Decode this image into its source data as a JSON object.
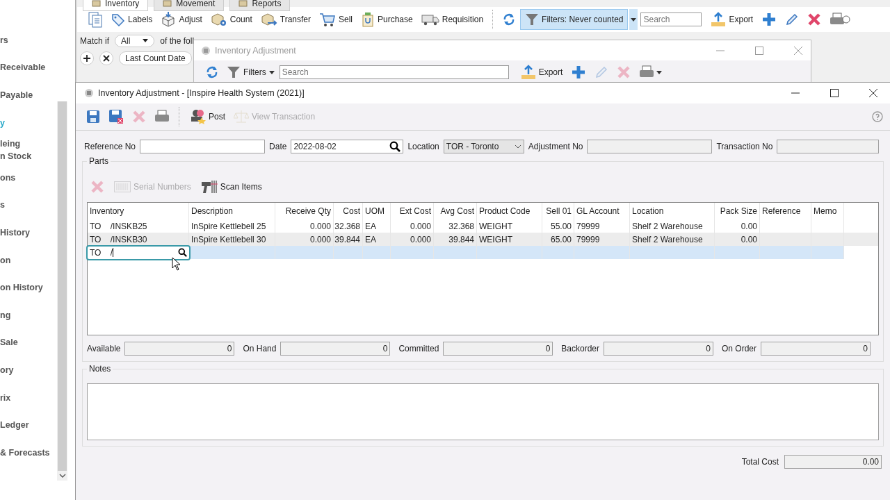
{
  "sidebar": {
    "items": [
      {
        "label": "rs",
        "selected": false
      },
      {
        "label": "Receivable",
        "selected": false
      },
      {
        "label": "Payable",
        "selected": false
      },
      {
        "label": "y",
        "selected": true
      },
      {
        "label": "leing\nn Stock",
        "selected": false
      },
      {
        "label": "ons",
        "selected": false
      },
      {
        "label": "s",
        "selected": false
      },
      {
        "label": "History",
        "selected": false
      },
      {
        "label": "on",
        "selected": false
      },
      {
        "label": "on History",
        "selected": false
      },
      {
        "label": "ng",
        "selected": false
      },
      {
        "label": "Sale",
        "selected": false
      },
      {
        "label": "ory",
        "selected": false
      },
      {
        "label": "rix",
        "selected": false
      },
      {
        "label": "Ledger",
        "selected": false
      },
      {
        "label": "& Forecasts",
        "selected": false
      }
    ]
  },
  "background_window": {
    "tabs": [
      {
        "label": "Inventory",
        "selected": true
      },
      {
        "label": "Movement",
        "selected": false
      },
      {
        "label": "Reports",
        "selected": false
      }
    ],
    "toolbar": [
      "Labels",
      "Adjust",
      "Count",
      "Transfer",
      "Sell",
      "Purchase",
      "Requisition"
    ],
    "filter": {
      "label": "Filters: Never counted",
      "selected": true
    },
    "search": {
      "placeholder": "Search"
    },
    "export": "Export",
    "match": {
      "label": "Match if",
      "value": "All",
      "suffix": "of the foll"
    },
    "condition": "Last Count Date"
  },
  "middle_window": {
    "title": "Inventory Adjustment",
    "filters": "Filters",
    "search": {
      "placeholder": "Search"
    },
    "export": "Export",
    "edit_disabled": true,
    "delete_disabled": true
  },
  "window": {
    "title": "Inventory Adjustment -  [Inspire Health System (2021)]",
    "toolbar": [
      {
        "label": "Post",
        "disabled": false
      },
      {
        "label": "View Transaction",
        "disabled": true
      }
    ],
    "delete_disabled": true,
    "fields": [
      {
        "label": "Reference No"
      },
      {
        "label": "Date",
        "value": "2022-08-02"
      },
      {
        "label": "Location",
        "value": "TOR - Toronto"
      },
      {
        "label": "Adjustment No"
      },
      {
        "label": "Transaction No"
      }
    ],
    "parts": {
      "label": "Parts",
      "delete_disabled": true,
      "tools": [
        {
          "label": "Serial Numbers",
          "disabled": true
        },
        {
          "label": "Scan Items",
          "disabled": false
        }
      ],
      "columns": [
        "Inventory",
        "Description",
        "Receive Qty",
        "Cost",
        "UOM",
        "Ext Cost",
        "Avg Cost",
        "Product Code",
        "Sell 01",
        "GL Account",
        "Location",
        "Pack Size",
        "Reference",
        "Memo"
      ],
      "rows": [
        {
          "cells": [
            "TO    /INSKB25",
            "InSpire Kettlebell 25",
            "0.000",
            "32.368",
            "EA",
            "0.000",
            "32.368",
            "WEIGHT",
            "55.00",
            "79999",
            "Shelf 2 Warehouse",
            "0.00"
          ],
          "selected": false,
          "editing": false
        },
        {
          "cells": [
            "TO    /INSKB30",
            "InSpire Kettlebell 30",
            "0.000",
            "39.844",
            "EA",
            "0.000",
            "39.844",
            "WEIGHT",
            "65.00",
            "79999",
            "Shelf 2 Warehouse",
            "0.00"
          ],
          "selected": false,
          "editing": false
        },
        {
          "cells": [
            "TO    /"
          ],
          "selected": true,
          "editing": true
        }
      ]
    },
    "summary": [
      {
        "label": "Available",
        "value": "0"
      },
      {
        "label": "On Hand",
        "value": "0"
      },
      {
        "label": "Committed",
        "value": "0"
      },
      {
        "label": "Backorder",
        "value": "0"
      },
      {
        "label": "On Order",
        "value": "0"
      }
    ],
    "notes": {
      "label": "Notes"
    },
    "total": {
      "label": "Total Cost",
      "value": "0.00"
    }
  }
}
